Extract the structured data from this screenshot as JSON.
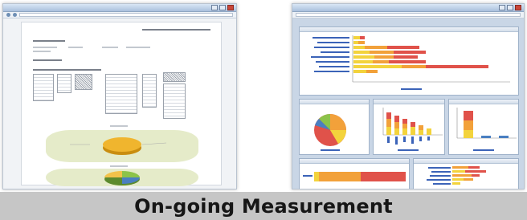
{
  "caption": {
    "text": "On-going Measurement"
  },
  "colors": {
    "caption_bg": "#c6c6c6",
    "bar_red": "#e0524a",
    "bar_orange": "#f2a13a",
    "bar_yellow": "#f3d33c",
    "pie_green": "#8cc34a",
    "pie_blue": "#4a7fc1",
    "link_blue": "#3b63b8"
  },
  "left_screenshot": {
    "icons": [
      "window-maximize-icon",
      "window-close-icon",
      "pie-chart-icon"
    ]
  },
  "right_screenshot": {
    "icons": [
      "window-close-icon",
      "horizontal-bar-chart-icon",
      "pie-chart-icon",
      "column-chart-icon"
    ]
  }
}
